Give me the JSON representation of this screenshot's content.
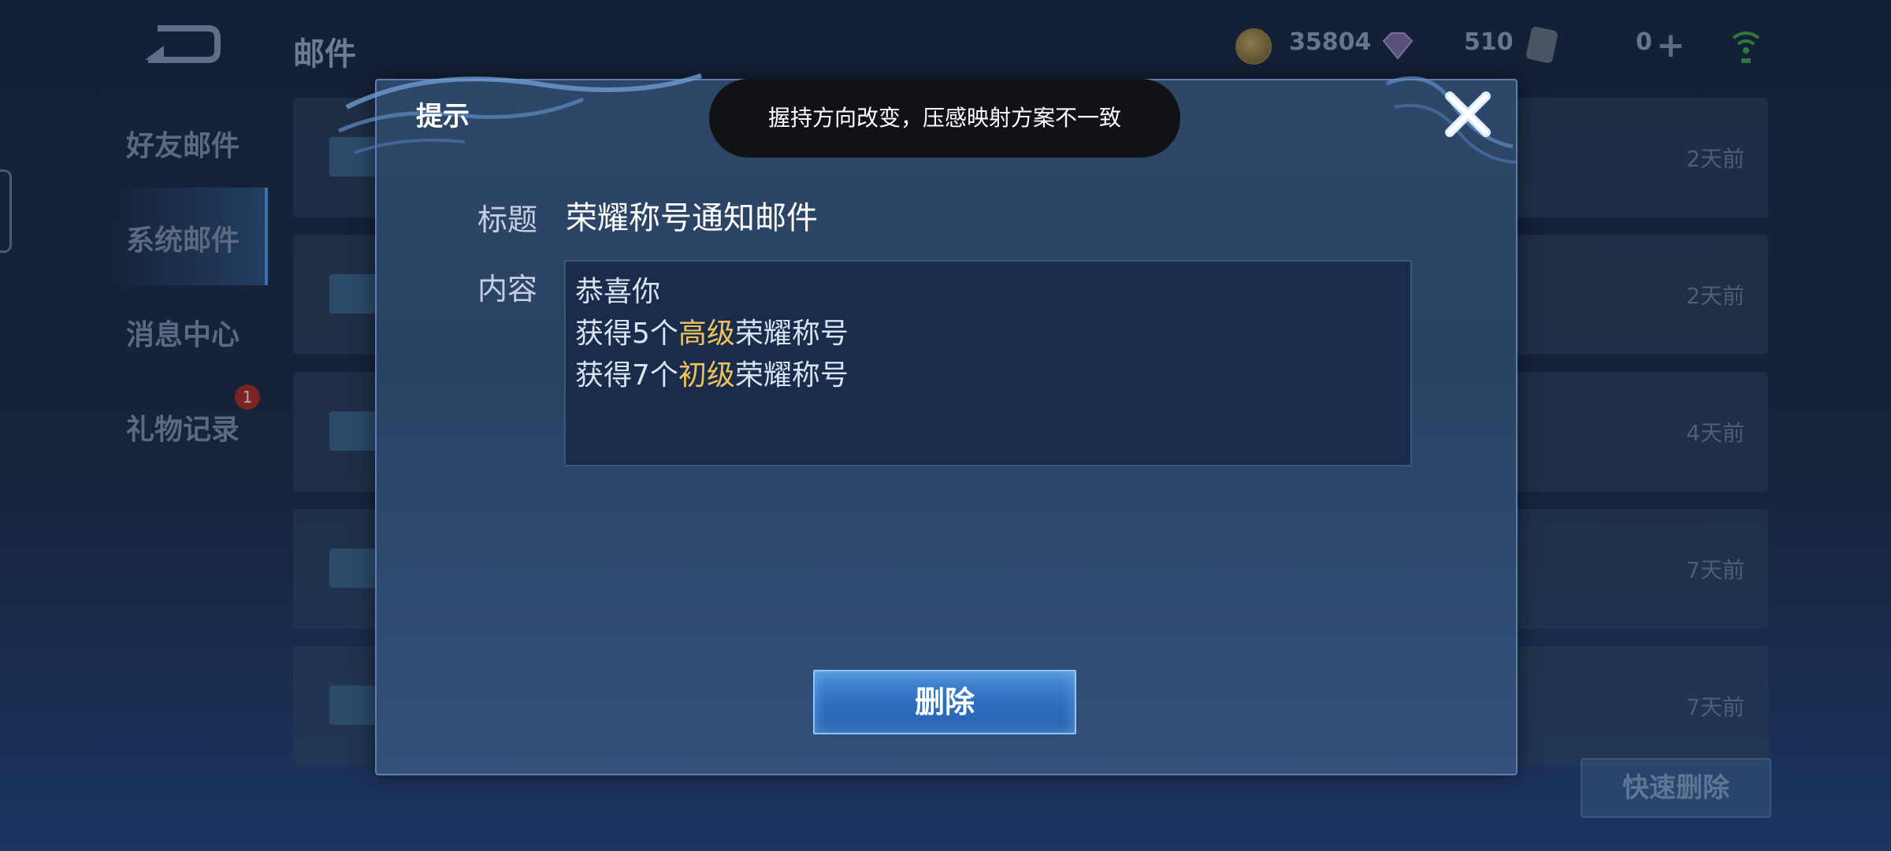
{
  "background": {
    "page_title": "邮件",
    "sidebar": [
      {
        "label": "好友邮件"
      },
      {
        "label": "系统邮件"
      },
      {
        "label": "消息中心"
      },
      {
        "label": "礼物记录"
      }
    ],
    "gift_badge_count": "1",
    "currency": {
      "coins": "35804",
      "gems": "510",
      "tickets": "0"
    },
    "mail_rows": [
      {
        "time": "2天前"
      },
      {
        "time": "2天前"
      },
      {
        "time": "4天前"
      },
      {
        "time": "7天前"
      },
      {
        "time": "7天前"
      }
    ],
    "quick_delete_label": "快速删除"
  },
  "dialog": {
    "title": "提示",
    "title_label": "标题",
    "title_value": "荣耀称号通知邮件",
    "content_label": "内容",
    "content": {
      "line1": "恭喜你",
      "line2_pre": "获得5个",
      "line2_hl": "高级",
      "line2_post": "荣耀称号",
      "line3_pre": "获得7个",
      "line3_hl": "初级",
      "line3_post": "荣耀称号"
    },
    "delete_label": "删除",
    "highlight_color": "#f0c25a"
  },
  "toast": {
    "text": "握持方向改变，压感映射方案不一致"
  },
  "icons": [
    "back-arrow-icon",
    "coin-icon",
    "gem-icon",
    "ticket-icon",
    "plus-icon",
    "wifi-icon",
    "close-icon"
  ]
}
